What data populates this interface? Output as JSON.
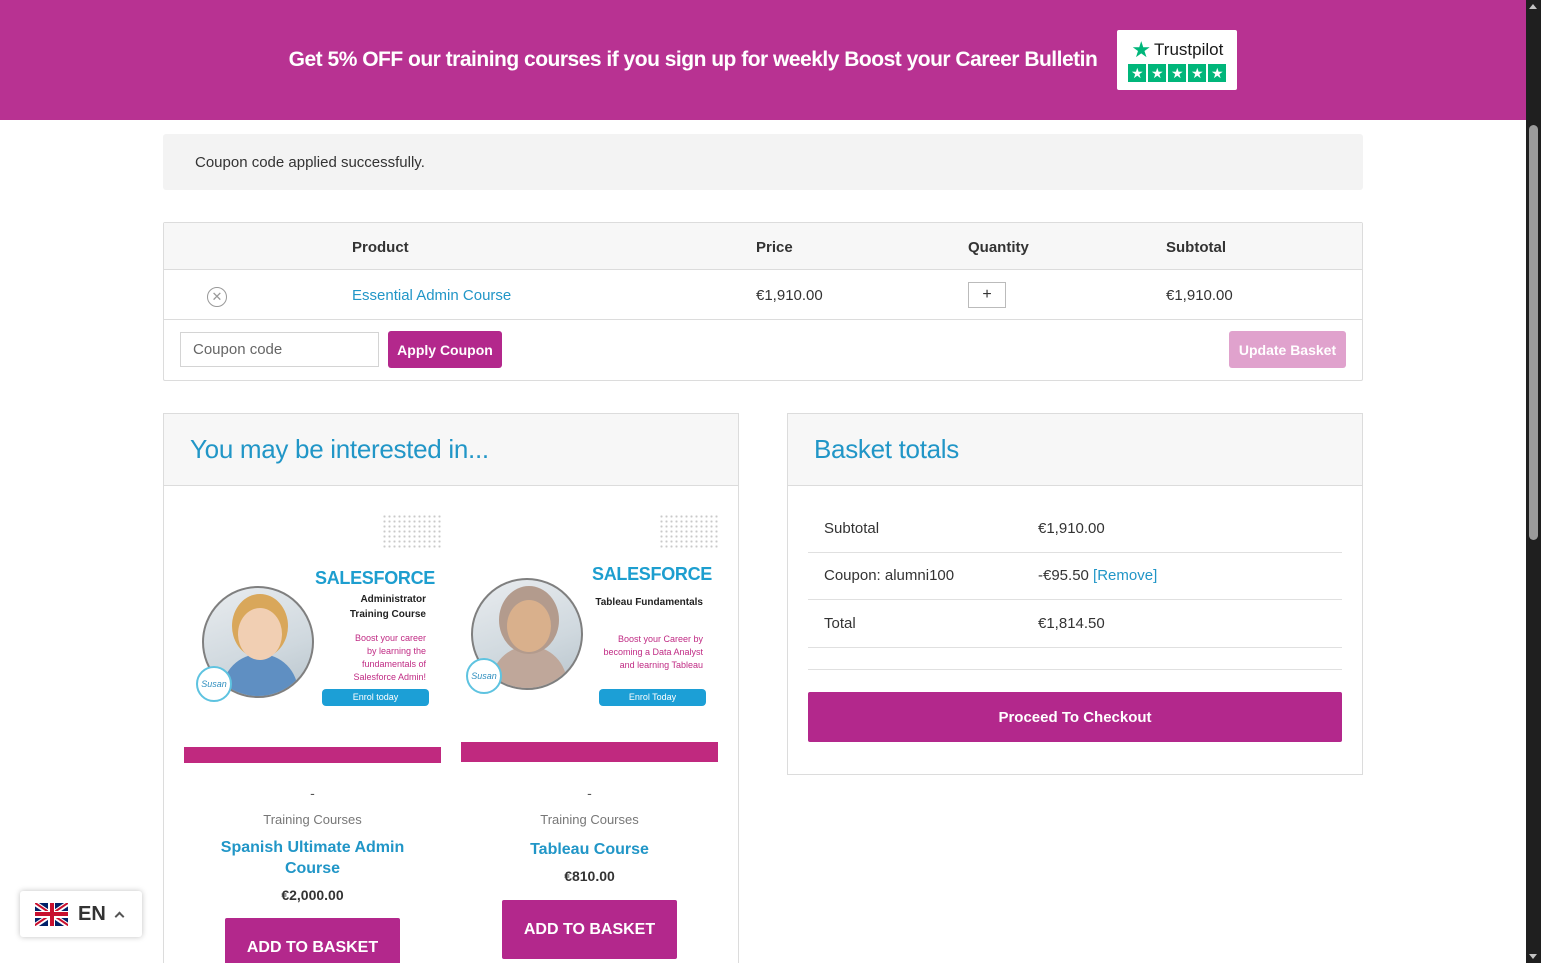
{
  "banner": {
    "text": "Get 5% OFF our training courses if you sign up for weekly Boost your Career Bulletin",
    "trustpilot_label": "Trustpilot",
    "trustpilot_stars": 5
  },
  "notice": {
    "message": "Coupon code applied successfully."
  },
  "cart": {
    "headers": [
      "Product",
      "Price",
      "Quantity",
      "Subtotal"
    ],
    "items": [
      {
        "name": "Essential Admin Course",
        "price": "€1,910.00",
        "quantity_symbol": "+",
        "subtotal": "€1,910.00"
      }
    ],
    "coupon_placeholder": "Coupon code",
    "apply_label": "Apply Coupon",
    "update_label": "Update Basket"
  },
  "interested": {
    "title": "You may be interested in...",
    "products": [
      {
        "image": {
          "headline": "SALESFORCE",
          "line1": "Administrator",
          "line2": "Training Course",
          "pink1": "Boost your career",
          "pink2": "by learning the",
          "pink3": "fundamentals of",
          "pink4": "Salesforce Admin!",
          "cta": "Enrol today",
          "logo": "Susan"
        },
        "dash": "-",
        "category": "Training Courses",
        "name": "Spanish Ultimate Admin Course",
        "price": "€2,000.00",
        "button": "ADD TO BASKET"
      },
      {
        "image": {
          "headline": "SALESFORCE",
          "line1": "Tableau Fundamentals",
          "pink1": "Boost your Career by",
          "pink2": "becoming a Data Analyst",
          "pink3": "and learning Tableau",
          "cta": "Enrol Today",
          "logo": "Susan"
        },
        "dash": "-",
        "category": "Training Courses",
        "name": "Tableau Course",
        "price": "€810.00",
        "button": "ADD TO BASKET"
      }
    ]
  },
  "totals": {
    "title": "Basket totals",
    "subtotal_label": "Subtotal",
    "subtotal_value": "€1,910.00",
    "coupon_label": "Coupon: alumni100",
    "coupon_value": "-€95.50",
    "coupon_remove": "[Remove]",
    "total_label": "Total",
    "total_value": "€1,814.50",
    "checkout_label": "Proceed To Checkout"
  },
  "language": {
    "code": "EN"
  },
  "colors": {
    "brand": "#b83292",
    "button": "#b3288c",
    "link": "#2196c7"
  }
}
